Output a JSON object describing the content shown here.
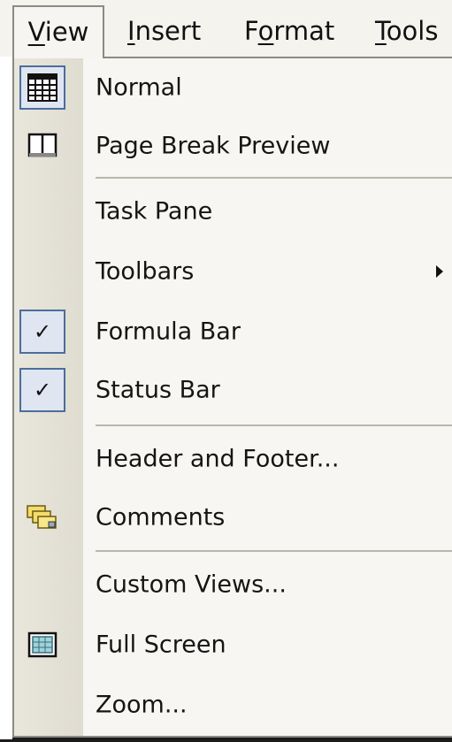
{
  "menubar": {
    "items": [
      {
        "label": "View",
        "mnemonic": "V"
      },
      {
        "label": "Insert",
        "mnemonic": "I"
      },
      {
        "label": "Format",
        "mnemonic": "o"
      },
      {
        "label": "Tools",
        "mnemonic": "T"
      }
    ]
  },
  "view_menu": {
    "items": [
      {
        "label": "Normal",
        "icon": "grid-sheet-icon",
        "checked": false
      },
      {
        "label": "Page Break Preview",
        "icon": "page-break-icon",
        "checked": false
      },
      {
        "label": "Task Pane",
        "icon": "",
        "checked": false
      },
      {
        "label": "Toolbars",
        "icon": "",
        "has_submenu": true
      },
      {
        "label": "Formula Bar",
        "icon": "checkmark-icon",
        "checked": true
      },
      {
        "label": "Status Bar",
        "icon": "checkmark-icon",
        "checked": true
      },
      {
        "label": "Header and Footer...",
        "icon": "",
        "checked": false
      },
      {
        "label": "Comments",
        "icon": "comments-icon",
        "checked": false
      },
      {
        "label": "Custom Views...",
        "icon": "",
        "checked": false
      },
      {
        "label": "Full Screen",
        "icon": "full-screen-icon",
        "checked": false
      },
      {
        "label": "Zoom...",
        "icon": "",
        "checked": false
      }
    ]
  },
  "colors": {
    "menu_background": "#f7f6f2",
    "icon_gutter": "#e3e0d5",
    "checked_border": "#4b6e9c",
    "checked_fill": "#dfe6f1",
    "separator": "#b9b6ad"
  }
}
